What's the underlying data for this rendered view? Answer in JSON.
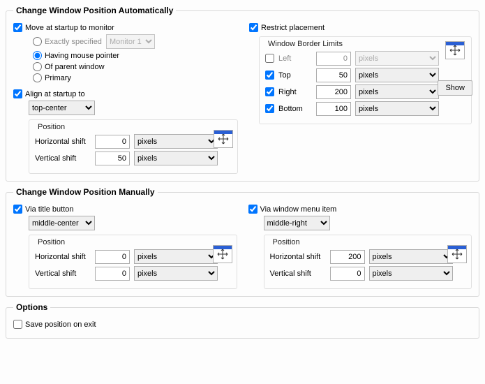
{
  "auto": {
    "legend": "Change Window Position Automatically",
    "move_startup": {
      "label": "Move at startup to monitor",
      "checked": true
    },
    "exactly": {
      "label": "Exactly specified",
      "checked": false,
      "monitor": "Monitor 1"
    },
    "mouse": {
      "label": "Having mouse pointer",
      "checked": true
    },
    "parent": {
      "label": "Of parent window",
      "checked": false
    },
    "primary": {
      "label": "Primary",
      "checked": false
    },
    "restrict": {
      "label": "Restrict placement",
      "checked": true
    },
    "border_title": "Window Border Limits",
    "limits": {
      "left": {
        "label": "Left",
        "checked": false,
        "value": "0",
        "unit": "pixels"
      },
      "top": {
        "label": "Top",
        "checked": true,
        "value": "50",
        "unit": "pixels"
      },
      "right": {
        "label": "Right",
        "checked": true,
        "value": "200",
        "unit": "pixels"
      },
      "bottom": {
        "label": "Bottom",
        "checked": true,
        "value": "100",
        "unit": "pixels"
      }
    },
    "show": "Show",
    "align": {
      "label": "Align at startup to",
      "checked": true,
      "value": "top-center"
    },
    "position_title": "Position",
    "hshift": {
      "label": "Horizontal shift",
      "value": "0",
      "unit": "pixels"
    },
    "vshift": {
      "label": "Vertical shift",
      "value": "50",
      "unit": "pixels"
    }
  },
  "manual": {
    "legend": "Change Window Position Manually",
    "titlebtn": {
      "label": "Via title button",
      "checked": true,
      "align": "middle-center"
    },
    "menuitem": {
      "label": "Via window menu item",
      "checked": true,
      "align": "middle-right"
    },
    "position_title": "Position",
    "left": {
      "h": {
        "label": "Horizontal shift",
        "value": "0",
        "unit": "pixels"
      },
      "v": {
        "label": "Vertical shift",
        "value": "0",
        "unit": "pixels"
      }
    },
    "right": {
      "h": {
        "label": "Horizontal shift",
        "value": "200",
        "unit": "pixels"
      },
      "v": {
        "label": "Vertical shift",
        "value": "0",
        "unit": "pixels"
      }
    }
  },
  "options": {
    "legend": "Options",
    "save": {
      "label": "Save position on exit",
      "checked": false
    }
  }
}
